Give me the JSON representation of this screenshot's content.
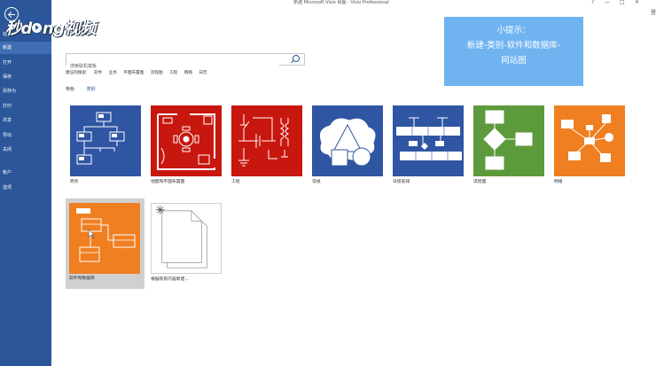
{
  "window": {
    "title": "新建 Microsoft Visio 绘图 - Visio Professional",
    "controls": [
      "?",
      "—",
      "□",
      "✕"
    ],
    "signin": "登"
  },
  "watermark": {
    "part1": "秒d",
    "part2": "ng视频"
  },
  "sidebar": {
    "items": [
      {
        "label": "信息"
      },
      {
        "label": "新建"
      },
      {
        "label": "打开"
      },
      {
        "label": "保存"
      },
      {
        "label": "另存为"
      },
      {
        "label": "打印"
      },
      {
        "label": "共享"
      },
      {
        "label": "导出"
      },
      {
        "label": "关闭"
      },
      {
        "label": "帐户"
      },
      {
        "label": "选项"
      }
    ]
  },
  "search": {
    "placeholder": "搜索联机模板"
  },
  "suggested": {
    "label": "建议的搜索:",
    "items": [
      "软件",
      "业务",
      "平面布置图",
      "流程图",
      "工程",
      "网络",
      "日历"
    ]
  },
  "tabs": [
    {
      "label": "特色"
    },
    {
      "label": "类别"
    }
  ],
  "tip": {
    "line1": "小提示：",
    "line2": "新建-类别-软件和数据库-",
    "line3": "网站图"
  },
  "colors": {
    "sidebar": "#2b579a",
    "blue_tile": "#2f55a3",
    "red_tile": "#c8170f",
    "green_tile": "#5d9a3c",
    "orange_tile": "#f07f21",
    "tip_box": "#70b3f1"
  },
  "templates": [
    {
      "label": "商务",
      "icon": "business-diagram-icon"
    },
    {
      "label": "地图和平面布置图",
      "icon": "floor-plan-icon"
    },
    {
      "label": "工程",
      "icon": "engineering-circuit-icon"
    },
    {
      "label": "常规",
      "icon": "basic-shapes-icon"
    },
    {
      "label": "日程安排",
      "icon": "schedule-timeline-icon"
    },
    {
      "label": "流程图",
      "icon": "flowchart-icon"
    },
    {
      "label": "网络",
      "icon": "network-icon"
    },
    {
      "label": "软件和数据库",
      "icon": "software-database-icon"
    },
    {
      "label": "根据现有内容新建...",
      "icon": "new-from-existing-icon"
    }
  ]
}
